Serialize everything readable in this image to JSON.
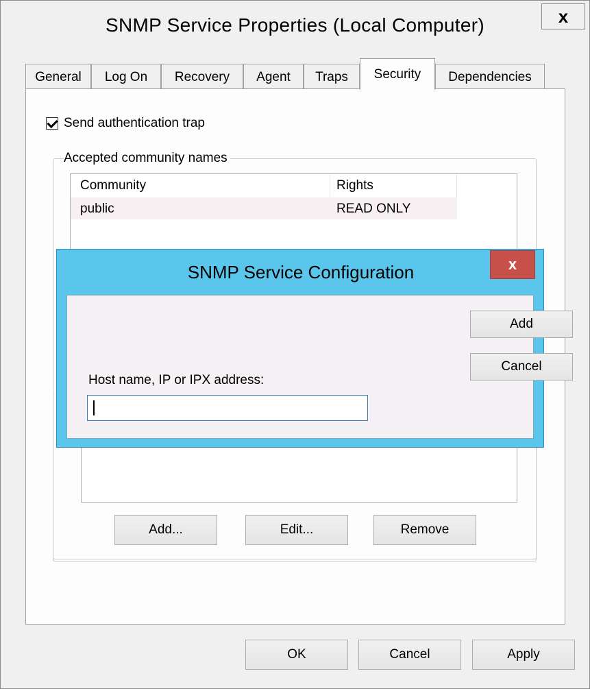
{
  "window": {
    "title": "SNMP Service Properties (Local Computer)",
    "close_glyph": "x"
  },
  "tabs": [
    {
      "label": "General"
    },
    {
      "label": "Log On"
    },
    {
      "label": "Recovery"
    },
    {
      "label": "Agent"
    },
    {
      "label": "Traps"
    },
    {
      "label": "Security",
      "active": true
    },
    {
      "label": "Dependencies"
    }
  ],
  "security": {
    "send_auth_trap_label": "Send authentication trap",
    "send_auth_trap_checked": true,
    "community_group_label": "Accepted community names",
    "community_columns": [
      "Community",
      "Rights"
    ],
    "community_rows": [
      {
        "community": "public",
        "rights": "READ ONLY"
      }
    ],
    "buttons": {
      "add": "Add...",
      "edit": "Edit...",
      "remove": "Remove"
    }
  },
  "dialog": {
    "title": "SNMP Service Configuration",
    "close_glyph": "x",
    "host_label": "Host name, IP or IPX address:",
    "host_value": "",
    "add_label": "Add",
    "cancel_label": "Cancel"
  },
  "footer": {
    "ok": "OK",
    "cancel": "Cancel",
    "apply": "Apply"
  },
  "colors": {
    "dialog_frame": "#5ac6ec",
    "dialog_close": "#c7504a",
    "window_bg": "#f0f0f0"
  }
}
